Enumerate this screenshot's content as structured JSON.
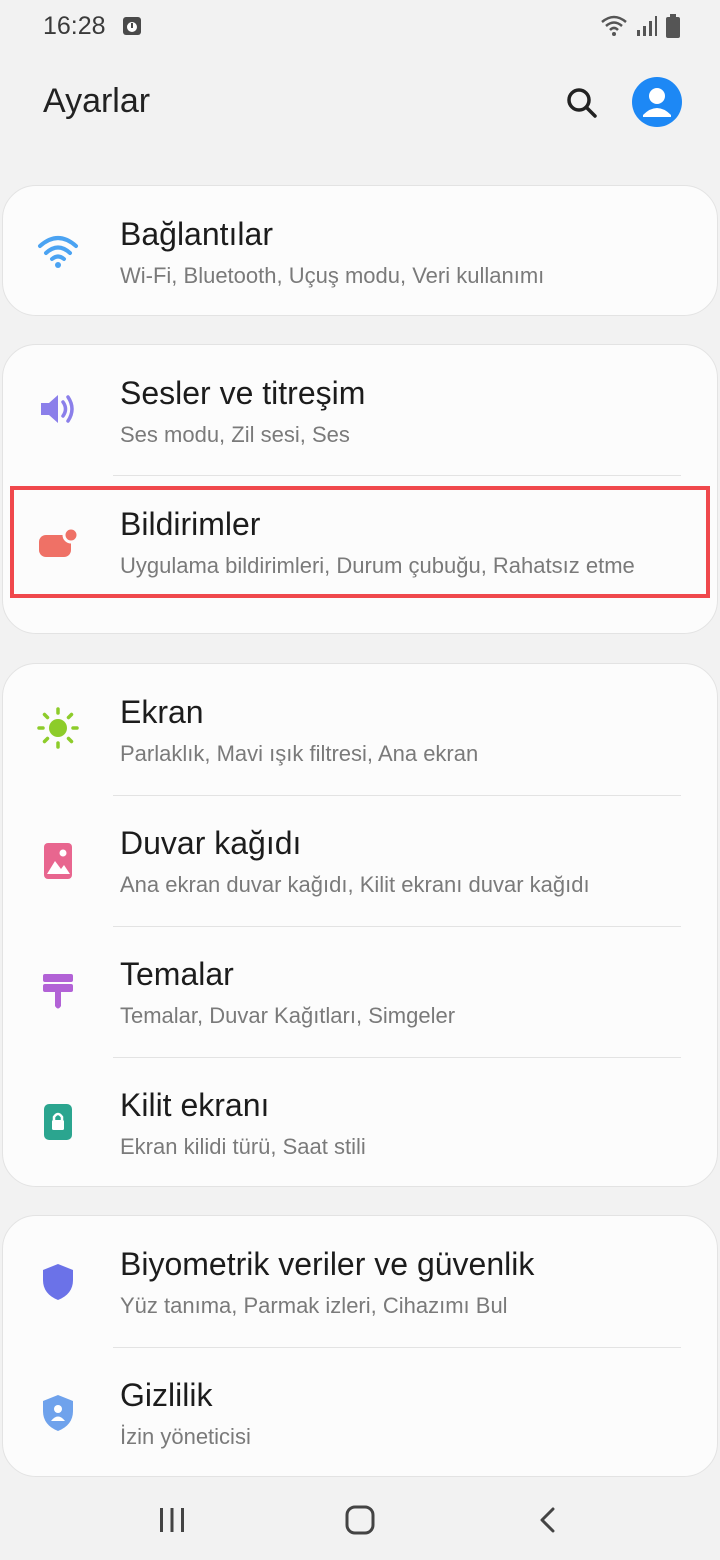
{
  "status_bar": {
    "time": "16:28",
    "icons": [
      "notification-icon",
      "wifi-icon",
      "signal-icon",
      "battery-icon"
    ]
  },
  "header": {
    "title": "Ayarlar",
    "search_icon": "search-icon",
    "profile_icon": "profile-icon"
  },
  "colors": {
    "accent": "#1d88f5",
    "highlight": "#f0484c",
    "connections": "#4ba3f2",
    "sounds": "#8b7fea",
    "notifications": "#ef7166",
    "display": "#8dcc2a",
    "wallpaper": "#e8668f",
    "themes": "#b262d6",
    "lockscreen": "#2ba58f",
    "security": "#6b72e8",
    "privacy": "#6fa2ec"
  },
  "settings": {
    "connections": {
      "title": "Bağlantılar",
      "subtitle": "Wi-Fi, Bluetooth, Uçuş modu, Veri kullanımı",
      "icon": "wifi-icon"
    },
    "sounds": {
      "title": "Sesler ve titreşim",
      "subtitle": "Ses modu, Zil sesi, Ses",
      "icon": "volume-icon"
    },
    "notifications": {
      "title": "Bildirimler",
      "subtitle": "Uygulama bildirimleri, Durum çubuğu, Rahatsız etme",
      "icon": "notification-badge-icon"
    },
    "display": {
      "title": "Ekran",
      "subtitle": "Parlaklık, Mavi ışık filtresi, Ana ekran",
      "icon": "sun-icon"
    },
    "wallpaper": {
      "title": "Duvar kağıdı",
      "subtitle": "Ana ekran duvar kağıdı, Kilit ekranı duvar kağıdı",
      "icon": "image-icon"
    },
    "themes": {
      "title": "Temalar",
      "subtitle": "Temalar, Duvar Kağıtları, Simgeler",
      "icon": "paint-brush-icon"
    },
    "lockscreen": {
      "title": "Kilit ekranı",
      "subtitle": "Ekran kilidi türü, Saat stili",
      "icon": "lock-icon"
    },
    "security": {
      "title": "Biyometrik veriler ve güvenlik",
      "subtitle": "Yüz tanıma, Parmak izleri, Cihazımı Bul",
      "icon": "shield-icon"
    },
    "privacy": {
      "title": "Gizlilik",
      "subtitle": "İzin yöneticisi",
      "icon": "privacy-shield-icon"
    }
  },
  "navbar": {
    "recents_icon": "recents-icon",
    "home_icon": "home-icon",
    "back_icon": "back-icon"
  }
}
